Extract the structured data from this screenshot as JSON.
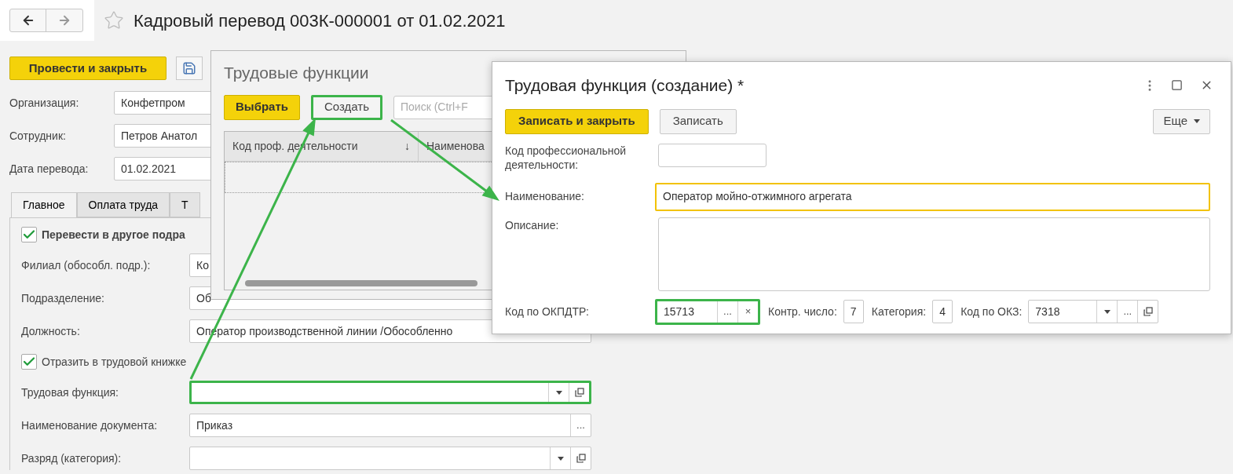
{
  "header": {
    "title": "Кадровый перевод 003К-000001 от 01.02.2021"
  },
  "form": {
    "toolbar": {
      "primary": "Провести и закрыть"
    },
    "fields": [
      {
        "label": "Организация:",
        "value": "Конфетпром"
      },
      {
        "label": "Сотрудник:",
        "value": "Петров Анатол"
      },
      {
        "label": "Дата перевода:",
        "value": "01.02.2021"
      }
    ],
    "tabs": [
      {
        "label": "Главное",
        "selected": true
      },
      {
        "label": "Оплата труда",
        "selected": false
      },
      {
        "label": "Т",
        "selected": false
      }
    ],
    "rows": [
      {
        "kind": "checkbox",
        "label": "Перевести в другое подра",
        "checked": true,
        "bold": true
      },
      {
        "kind": "field",
        "label": "Филиал (обособл. подр.):",
        "value": "Ко",
        "highlighted": false
      },
      {
        "kind": "field",
        "label": "Подразделение:",
        "value": "Об",
        "highlighted": false
      },
      {
        "kind": "field",
        "label": "Должность:",
        "value": "Оператор производственной линии /Обособленно",
        "highlighted": false
      },
      {
        "kind": "checkbox",
        "label": "Отразить в трудовой книжке",
        "checked": true,
        "bold": false
      },
      {
        "kind": "field",
        "label": "Трудовая функция:",
        "value": "",
        "highlighted": true,
        "buttons": [
          {
            "kind": "dropdown"
          },
          {
            "kind": "open"
          }
        ]
      },
      {
        "kind": "field",
        "label": "Наименование документа:",
        "value": "Приказ",
        "highlighted": false,
        "buttons": [
          {
            "kind": "choose",
            "text": "..."
          }
        ]
      },
      {
        "kind": "field",
        "label": "Разряд (категория):",
        "value": "",
        "highlighted": false,
        "buttons": [
          {
            "kind": "dropdown"
          },
          {
            "kind": "open"
          }
        ]
      }
    ]
  },
  "list_dialog": {
    "title": "Трудовые функции",
    "buttons": [
      {
        "label": "Выбрать",
        "kind": "primary",
        "highlighted": false
      },
      {
        "label": "Создать",
        "kind": "default",
        "highlighted": true
      }
    ],
    "search": {
      "placeholder": "Поиск (Ctrl+F"
    },
    "table": {
      "columns": [
        {
          "label": "Код проф. деятельности",
          "sort": "↓"
        },
        {
          "label": "Наименова"
        }
      ]
    }
  },
  "create_dialog": {
    "title": "Трудовая функция (создание) *",
    "buttons": [
      {
        "label": "Записать и закрыть",
        "kind": "primary"
      },
      {
        "label": "Записать",
        "kind": "default"
      }
    ],
    "more": {
      "label": "Еще"
    },
    "code_field": {
      "label": "Код профессиональной деятельности:"
    },
    "name_field": {
      "label": "Наименование:",
      "value": "Оператор мойно-отжимного агрегата",
      "focused": true
    },
    "description_field": {
      "label": "Описание:"
    },
    "bottom_row": [
      {
        "label": "Код по ОКПДТР:",
        "value": "15713",
        "highlighted": true,
        "buttons": [
          {
            "kind": "choose",
            "text": "..."
          },
          {
            "kind": "clear",
            "text": "×"
          }
        ]
      },
      {
        "label": "Контр. число:",
        "value": "7",
        "highlighted": false
      },
      {
        "label": "Категория:",
        "value": "4",
        "highlighted": false
      },
      {
        "label": "Код по ОКЗ:",
        "value": "7318",
        "highlighted": false,
        "buttons": [
          {
            "kind": "dropdown"
          },
          {
            "kind": "choose",
            "text": "..."
          },
          {
            "kind": "open"
          }
        ]
      }
    ]
  }
}
